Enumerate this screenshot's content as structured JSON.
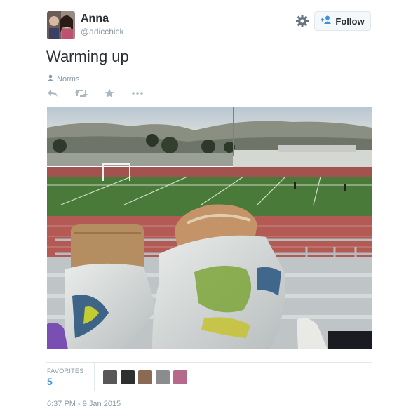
{
  "user": {
    "name": "Anna",
    "handle": "@adicchick"
  },
  "header": {
    "follow_label": "Follow",
    "icons": [
      "gear-icon",
      "follow-person-icon"
    ]
  },
  "tweet": {
    "text": "Warming up",
    "place": "Norms"
  },
  "actions": [
    "reply-icon",
    "retweet-icon",
    "favorite-icon",
    "more-icon"
  ],
  "stats": {
    "favorites_label": "FAVORITES",
    "favorites_count": "5"
  },
  "timestamp": "6:37 PM - 9 Jan 2015",
  "colors": {
    "link_blue": "#3b94d9",
    "muted": "#8899a6",
    "text": "#292f33",
    "border": "#e1e8ed"
  }
}
